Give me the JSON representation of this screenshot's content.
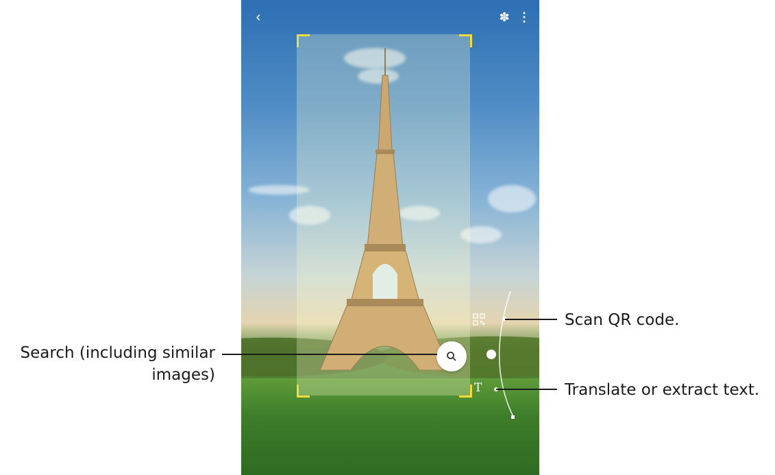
{
  "toolbar": {
    "back_icon": "chevron-left-icon",
    "bixby_icon": "bixby-vision-icon",
    "more_icon": "more-options-icon",
    "back_glyph": "‹",
    "bixby_glyph": "✽",
    "more_glyph": "⋮"
  },
  "scene": {
    "selection_color": "#f1dc3a"
  },
  "controls": {
    "search_icon": "search-icon",
    "qr_icon": "qr-code-icon",
    "text_icon": "text-icon",
    "text_glyph": "T"
  },
  "callouts": {
    "search_line1": "Search (including similar",
    "search_line2": "images)",
    "qr": "Scan QR code.",
    "text": "Translate or extract text."
  }
}
